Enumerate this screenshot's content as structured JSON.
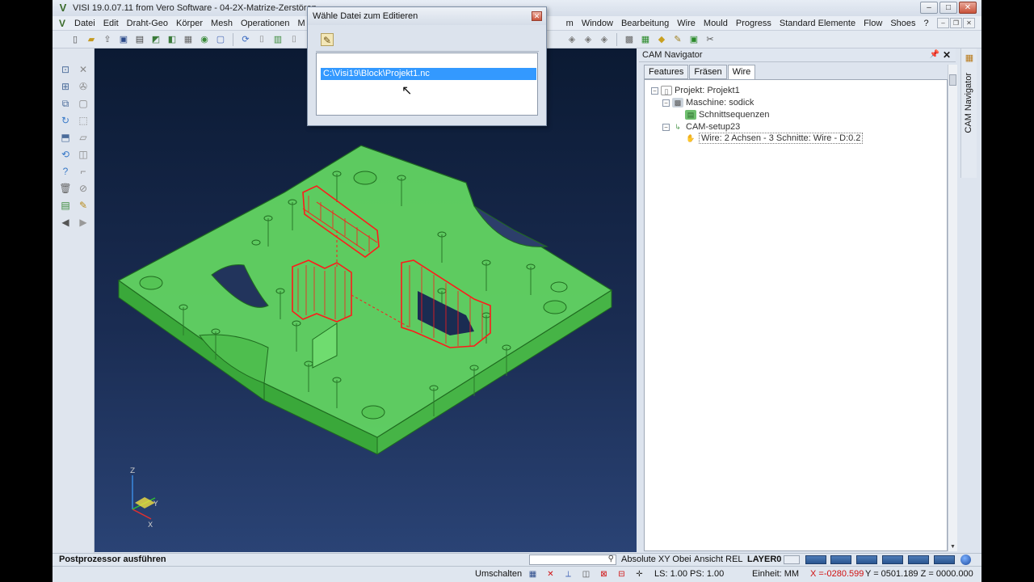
{
  "window": {
    "title": "VISI 19.0.07.11 from Vero Software - 04-2X-Matrize-Zerstören-"
  },
  "menubar": {
    "items_left": [
      "Datei",
      "Edit",
      "Draht-Geo",
      "Körper",
      "Mesh",
      "Operationen",
      "M"
    ],
    "items_right": [
      "m",
      "Window",
      "Bearbeitung",
      "Wire",
      "Mould",
      "Progress",
      "Standard Elemente",
      "Flow",
      "Shoes",
      "?"
    ]
  },
  "dialog": {
    "title": "Wähle Datei zum Editieren",
    "file_item": "C:\\Visi19\\Block\\Projekt1.nc"
  },
  "cam_navigator": {
    "title": "CAM Navigator",
    "side_label": "CAM Navigator",
    "tabs": [
      "Features",
      "Fräsen",
      "Wire"
    ],
    "active_tab": "Wire",
    "tree": [
      {
        "label": "Projekt: Projekt1"
      },
      {
        "label": "Maschine: sodick"
      },
      {
        "label": "Schnittsequenzen"
      },
      {
        "label": "CAM-setup23"
      },
      {
        "label": "Wire: 2 Achsen - 3 Schnitte: Wire - D:0.2"
      }
    ]
  },
  "statusbar": {
    "prompt": "Postprozessor ausführen",
    "absolute": "Absolute XY Obei",
    "ansicht": "Ansicht REL",
    "layer": "LAYER0",
    "umschalten": "Umschalten",
    "ls_ps": "LS: 1.00 PS: 1.00",
    "einheit": "Einheit: MM",
    "x_coord": "X =-0280.599",
    "yz_coord": "Y = 0501.189 Z = 0000.000"
  },
  "axis": {
    "x": "X",
    "y": "Y",
    "z": "Z"
  },
  "colors": {
    "part_fill": "#5fd45f",
    "part_edge": "#1f6b1f",
    "wire_paths": "#ff1a1a",
    "selection": "#3399ff"
  }
}
